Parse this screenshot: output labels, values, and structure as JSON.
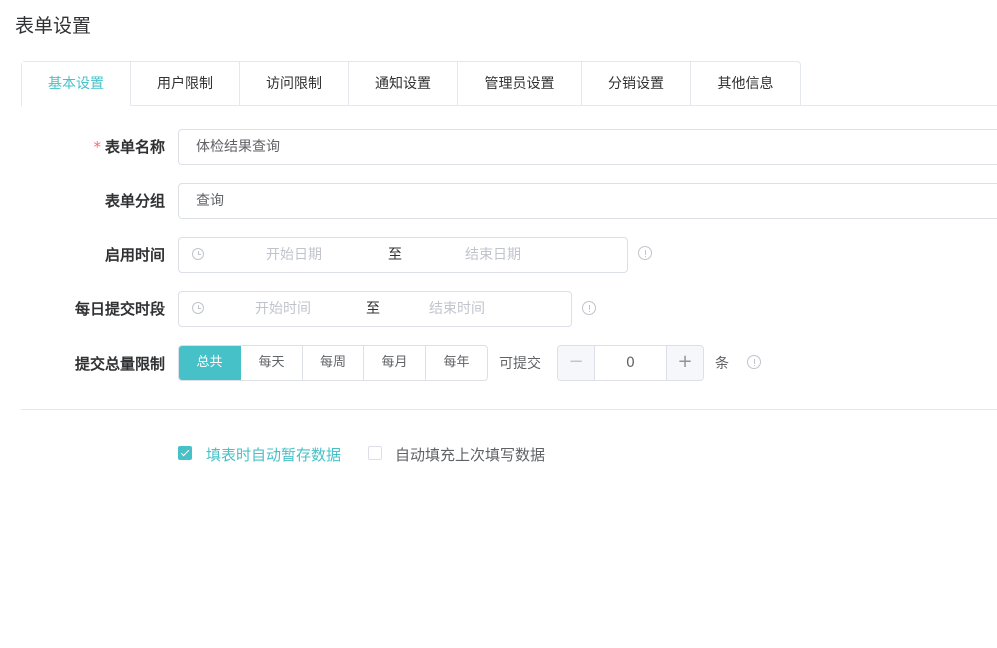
{
  "page": {
    "title": "表单设置"
  },
  "tabs": [
    {
      "label": "基本设置",
      "active": true
    },
    {
      "label": "用户限制"
    },
    {
      "label": "访问限制"
    },
    {
      "label": "通知设置"
    },
    {
      "label": "管理员设置"
    },
    {
      "label": "分销设置"
    },
    {
      "label": "其他信息"
    }
  ],
  "form": {
    "name": {
      "label": "表单名称",
      "required_mark": "*",
      "value": "体检结果查询"
    },
    "group": {
      "label": "表单分组",
      "value": "查询"
    },
    "enable_time": {
      "label": "启用时间",
      "start_placeholder": "开始日期",
      "separator": "至",
      "end_placeholder": "结束日期"
    },
    "daily_period": {
      "label": "每日提交时段",
      "start_placeholder": "开始时间",
      "separator": "至",
      "end_placeholder": "结束时间"
    },
    "submit_limit": {
      "label": "提交总量限制",
      "options": [
        "总共",
        "每天",
        "每周",
        "每月",
        "每年"
      ],
      "selected": "总共",
      "prefix": "可提交",
      "minus": "−",
      "value": "0",
      "plus": "+",
      "unit": "条"
    }
  },
  "options": {
    "auto_save": {
      "label": "填表时自动暂存数据",
      "checked": true
    },
    "auto_fill": {
      "label": "自动填充上次填写数据",
      "checked": false
    }
  },
  "colors": {
    "accent": "#47c1c8",
    "required": "#f56c6c",
    "border": "#dcdfe6"
  },
  "icons": [
    "clock-icon",
    "info-icon",
    "check-icon"
  ]
}
